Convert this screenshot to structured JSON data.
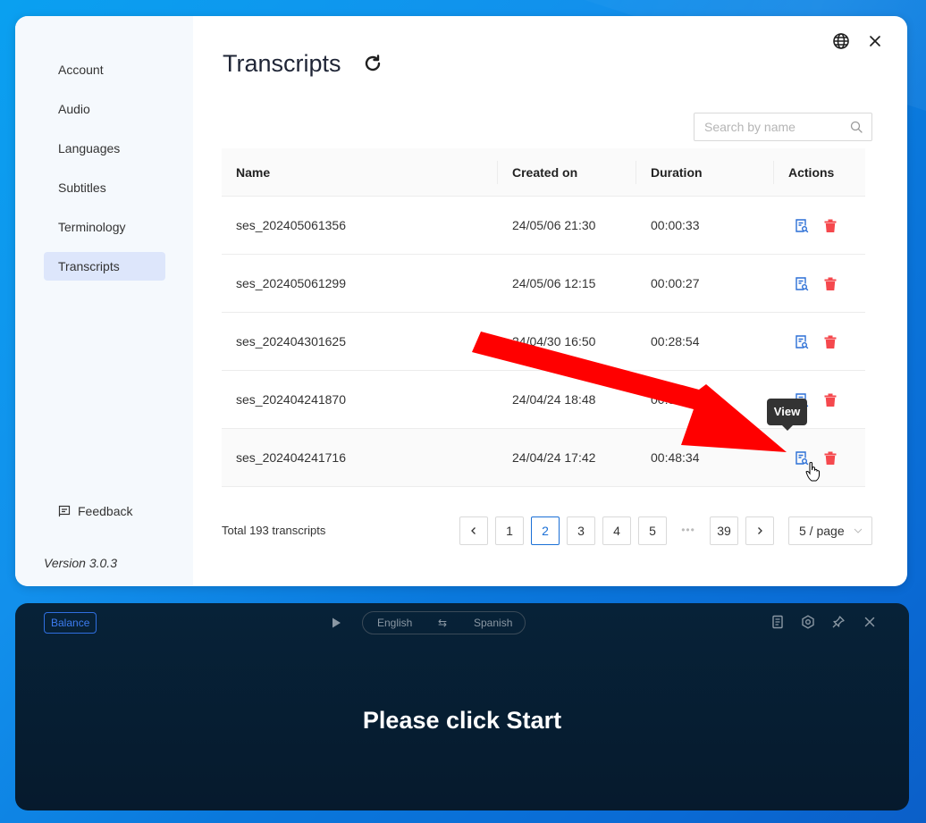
{
  "sidebar": {
    "items": [
      {
        "label": "Account"
      },
      {
        "label": "Audio"
      },
      {
        "label": "Languages"
      },
      {
        "label": "Subtitles"
      },
      {
        "label": "Terminology"
      },
      {
        "label": "Transcripts",
        "active": true
      }
    ],
    "feedback_label": "Feedback",
    "version": "Version 3.0.3"
  },
  "header": {
    "title": "Transcripts",
    "icons": [
      "refresh-icon",
      "globe-icon",
      "close-icon"
    ]
  },
  "search": {
    "placeholder": "Search by name",
    "value": ""
  },
  "table": {
    "columns": [
      "Name",
      "Created on",
      "Duration",
      "Actions"
    ],
    "rows": [
      {
        "name": "ses_202405061356",
        "created": "24/05/06 21:30",
        "duration": "00:00:33"
      },
      {
        "name": "ses_202405061299",
        "created": "24/05/06 12:15",
        "duration": "00:00:27"
      },
      {
        "name": "ses_202404301625",
        "created": "24/04/30 16:50",
        "duration": "00:28:54"
      },
      {
        "name": "ses_202404241870",
        "created": "24/04/24 18:48",
        "duration": "00:39:44"
      },
      {
        "name": "ses_202404241716",
        "created": "24/04/24 17:42",
        "duration": "00:48:34"
      }
    ],
    "actions": [
      "view-icon",
      "delete-icon"
    ],
    "tooltip": "View"
  },
  "pagination": {
    "total_text": "Total 193 transcripts",
    "pages": [
      "1",
      "2",
      "3",
      "4",
      "5"
    ],
    "ellipsis": "•••",
    "last_page": "39",
    "current": "2",
    "page_size": "5 / page"
  },
  "widget": {
    "mode_label": "Balance",
    "source_lang": "English",
    "target_lang": "Spanish",
    "swap_glyph": "⇆",
    "message": "Please click Start",
    "icons": [
      "play-icon",
      "document-icon",
      "settings-icon",
      "pin-icon",
      "close-icon"
    ]
  },
  "colors": {
    "accent": "#1a6fd6",
    "delete": "#f5484d",
    "active_nav": "#dde6fb",
    "widget_bg": "#061c30",
    "annotation_arrow": "#ff0000"
  }
}
